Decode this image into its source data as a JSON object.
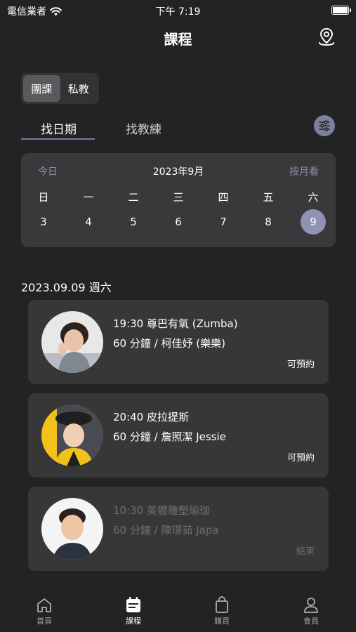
{
  "status_bar": {
    "carrier": "電信業者",
    "time": "下午 7:19",
    "battery_level": 1.0
  },
  "header": {
    "title": "課程"
  },
  "segment": {
    "items": [
      "團課",
      "私教"
    ],
    "selected": "團課"
  },
  "tabs": {
    "find_date": "找日期",
    "find_coach": "找教練"
  },
  "calendar": {
    "today": "今日",
    "month": "2023年9月",
    "by_month": "按月看",
    "weekdays": [
      "日",
      "一",
      "二",
      "三",
      "四",
      "五",
      "六"
    ],
    "dates": [
      "3",
      "4",
      "5",
      "6",
      "7",
      "8",
      "9"
    ],
    "selected_date": "9"
  },
  "date_heading": "2023.09.09 週六",
  "classes": [
    {
      "line1": "19:30 尊巴有氧 (Zumba)",
      "line2": "60 分鐘 / 柯佳妤 (樂樂)",
      "status": "可預約"
    },
    {
      "line1": "20:40 皮拉提斯",
      "line2": "60 分鐘 / 詹照潔 Jessie",
      "status": "可預約"
    },
    {
      "line1": "10:30 美體雕塑瑜珈",
      "line2": "60 分鐘 / 陳璟茹  Japa",
      "status": "結束"
    }
  ],
  "bottom_nav": [
    {
      "label": "首頁",
      "icon": "home-icon"
    },
    {
      "label": "課程",
      "icon": "calendar-icon"
    },
    {
      "label": "購買",
      "icon": "shopping-bag-icon"
    },
    {
      "label": "會員",
      "icon": "person-icon"
    }
  ],
  "colors": {
    "background": "#232323",
    "card": "#373737",
    "accent": "#8e93b4",
    "underline": "#6e7aa8"
  }
}
